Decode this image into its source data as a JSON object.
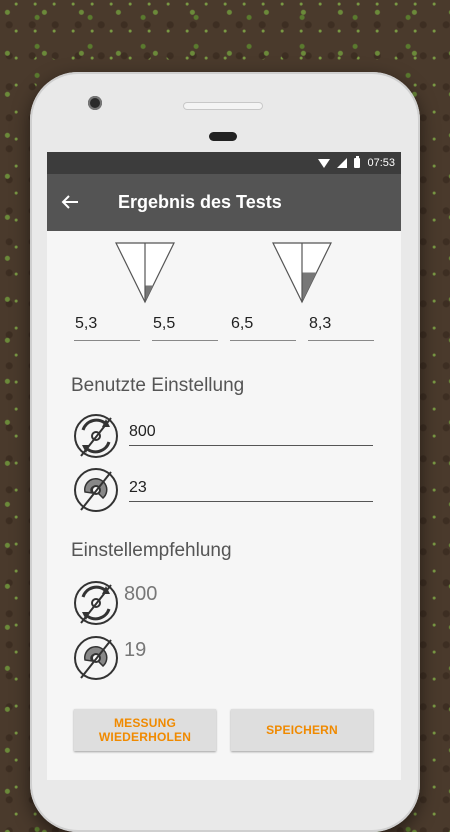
{
  "status_bar": {
    "time": "07:53"
  },
  "toolbar": {
    "back_icon": "arrow-back-icon",
    "title": "Ergebnis des Tests"
  },
  "measurements": {
    "funnels": [
      {
        "icon": "funnel-gauge-icon",
        "fill_level": 0.28
      },
      {
        "icon": "funnel-gauge-icon",
        "fill_level": 0.5
      }
    ],
    "values": [
      "5,3",
      "5,5",
      "6,5",
      "8,3"
    ]
  },
  "used_settings": {
    "title": "Benutzte Einstellung",
    "rpm": {
      "icon": "rotation-speed-icon",
      "value": "800"
    },
    "disc": {
      "icon": "spreader-disc-icon",
      "value": "23"
    }
  },
  "recommendation": {
    "title": "Einstellempfehlung",
    "rpm": {
      "icon": "rotation-speed-icon",
      "value": "800"
    },
    "disc": {
      "icon": "spreader-disc-icon",
      "value": "19"
    }
  },
  "buttons": {
    "repeat": "MESSUNG\nWIEDERHOLEN",
    "save": "SPEICHERN"
  },
  "colors": {
    "accent": "#f08a00",
    "toolbar": "#545454",
    "statusbar": "#3c3c3c"
  }
}
